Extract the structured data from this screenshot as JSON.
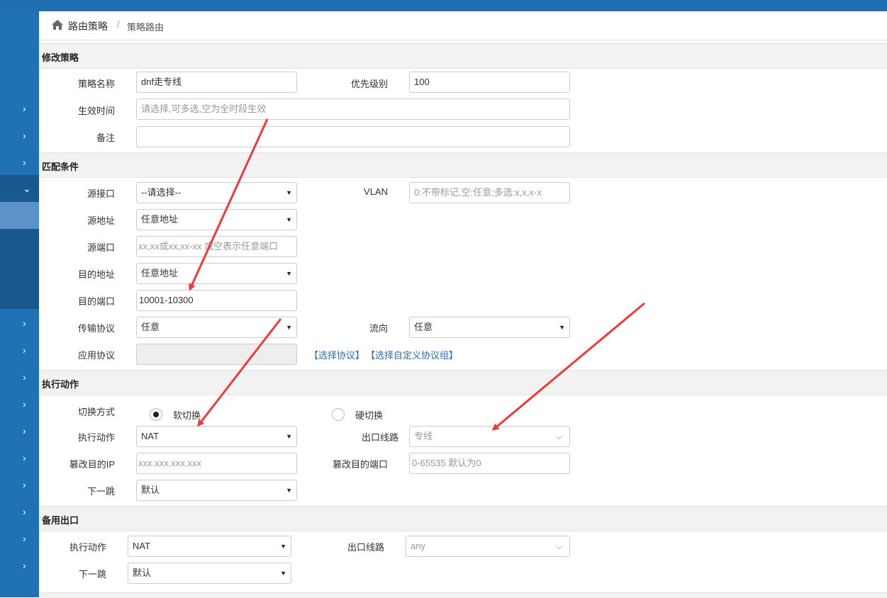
{
  "breadcrumb": {
    "home_icon": "home-icon",
    "parent": "路由策略",
    "separator": "/",
    "current": "策略路由"
  },
  "sidebar": {
    "chevron": "›",
    "open_chevron": "⌄"
  },
  "sections": {
    "modify": "修改策略",
    "match": "匹配条件",
    "action": "执行动作",
    "backup": "备用出口"
  },
  "modify": {
    "name_label": "策略名称",
    "name_value": "dnf走专线",
    "priority_label": "优先级别",
    "priority_value": "100",
    "time_label": "生效时间",
    "time_placeholder": "请选择,可多选,空为全时段生效",
    "remark_label": "备注",
    "remark_value": ""
  },
  "match": {
    "src_iface_label": "源接口",
    "src_iface_value": "--请选择--",
    "vlan_label": "VLAN",
    "vlan_placeholder": "0:不带标记,空:任意;多选:x,x,x-x",
    "src_addr_label": "源地址",
    "src_addr_value": "任意地址",
    "src_port_label": "源端口",
    "src_port_placeholder": "xx,xx或xx,xx-xx 或空表示任意端口",
    "dst_addr_label": "目的地址",
    "dst_addr_value": "任意地址",
    "dst_port_label": "目的端口",
    "dst_port_value": "10001-10300",
    "transport_label": "传输协议",
    "transport_value": "任意",
    "direction_label": "流向",
    "direction_value": "任意",
    "app_label": "应用协议",
    "select_protocol": "【选择协议】",
    "select_custom_group": "【选择自定义协议组】"
  },
  "action": {
    "switch_label": "切换方式",
    "soft_switch": "软切换",
    "hard_switch": "硬切换",
    "exec_label": "执行动作",
    "exec_value": "NAT",
    "out_line_label": "出口线路",
    "out_line_placeholder": "专线",
    "tamper_ip_label": "篡改目的IP",
    "tamper_ip_placeholder": "xxx.xxx.xxx.xxx",
    "tamper_port_label": "篡改目的端口",
    "tamper_port_placeholder": "0-65535 默认为0",
    "next_hop_label": "下一跳",
    "next_hop_value": "默认"
  },
  "backup": {
    "exec_label": "执行动作",
    "exec_value": "NAT",
    "out_line_label": "出口线路",
    "out_line_placeholder": "any",
    "next_hop_label": "下一跳",
    "next_hop_value": "默认"
  },
  "colors": {
    "sidebar": "#1f72b6",
    "accent_link": "#2a6fb0",
    "arrow": "#f0393a"
  }
}
